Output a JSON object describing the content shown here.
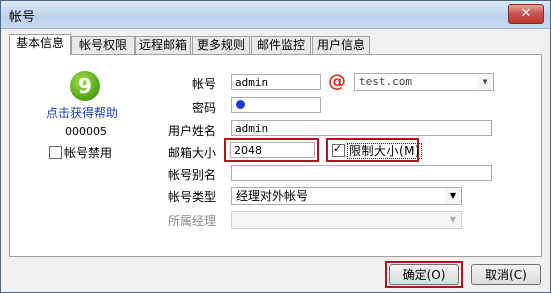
{
  "window": {
    "title": "帐号",
    "close_label": "✕"
  },
  "tabs": [
    {
      "label": "基本信息"
    },
    {
      "label": "帐号权限"
    },
    {
      "label": "远程邮箱"
    },
    {
      "label": "更多规则"
    },
    {
      "label": "邮件监控"
    },
    {
      "label": "用户信息"
    }
  ],
  "left": {
    "logo_glyph": "9",
    "help_link": "点击获得帮助",
    "account_id": "000005",
    "disable_label": "帐号禁用",
    "disable_checked": false
  },
  "form": {
    "account_label": "帐号",
    "account_value": "admin",
    "domain_value": "test.com",
    "password_label": "密码",
    "username_label": "用户姓名",
    "username_value": "admin",
    "mailbox_size_label": "邮箱大小",
    "mailbox_size_value": "2048",
    "limit_size_label": "限制大小(M)",
    "limit_size_checked": true,
    "alias_label": "帐号别名",
    "alias_value": "",
    "type_label": "帐号类型",
    "type_value": "经理对外帐号",
    "manager_label": "所属经理",
    "manager_value": ""
  },
  "buttons": {
    "ok": "确定(O)",
    "cancel": "取消(C)"
  },
  "colors": {
    "highlight": "#b0161c",
    "link": "#1a3fbf"
  }
}
